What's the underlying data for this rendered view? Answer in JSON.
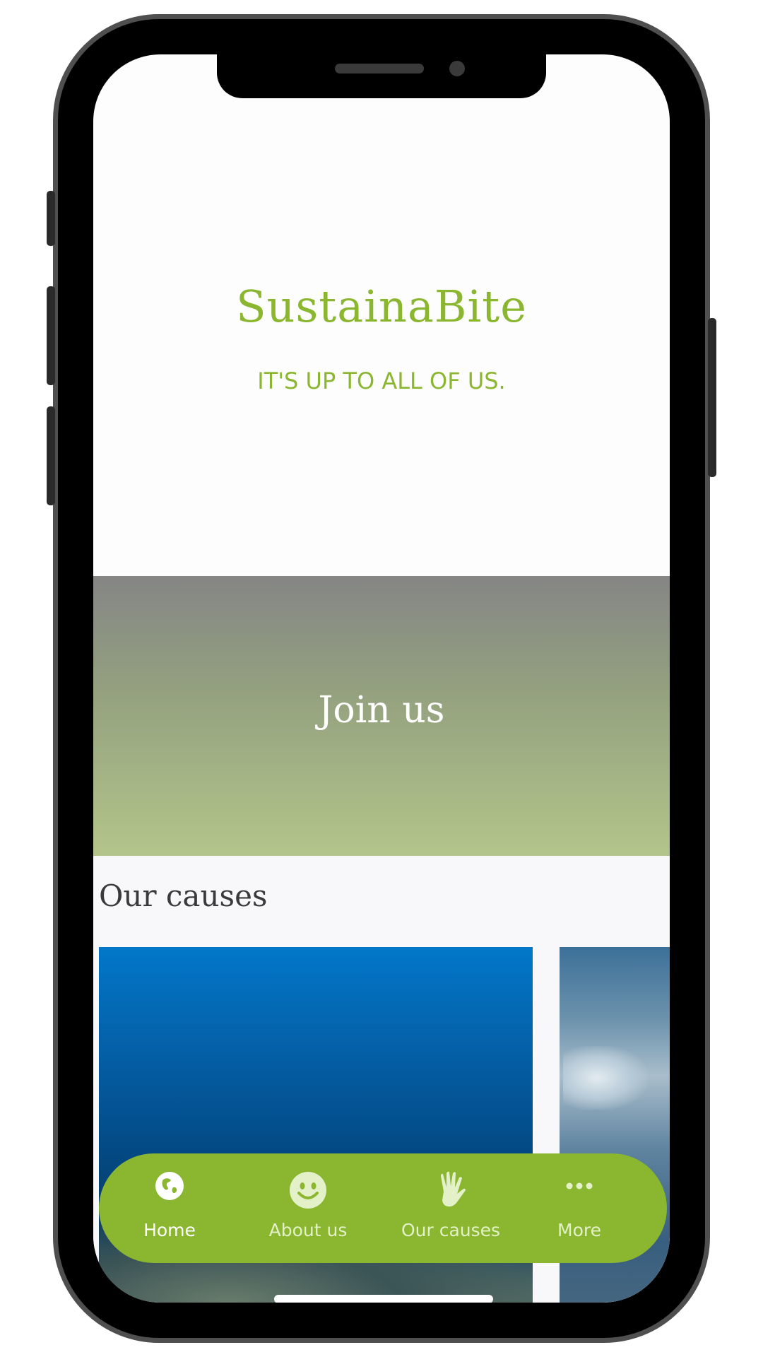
{
  "brand": {
    "title": "SustainaBite",
    "tagline": "IT'S UP TO ALL OF US."
  },
  "banner": {
    "label": "Join us"
  },
  "causes": {
    "title": "Our causes",
    "cards": [
      {
        "image": "ocean-underwater-photo"
      },
      {
        "image": "ocean-surface-waves-photo"
      }
    ]
  },
  "nav": {
    "items": [
      {
        "label": "Home",
        "icon": "globe-icon",
        "active": true
      },
      {
        "label": "About us",
        "icon": "smiley-icon",
        "active": false
      },
      {
        "label": "Our causes",
        "icon": "hand-icon",
        "active": false
      },
      {
        "label": "More",
        "icon": "more-dots-icon",
        "active": false
      }
    ]
  },
  "colors": {
    "brand_green": "#8ab72f",
    "text_dark": "#3a3a3a",
    "frame_gray": "#4f4f4f"
  }
}
